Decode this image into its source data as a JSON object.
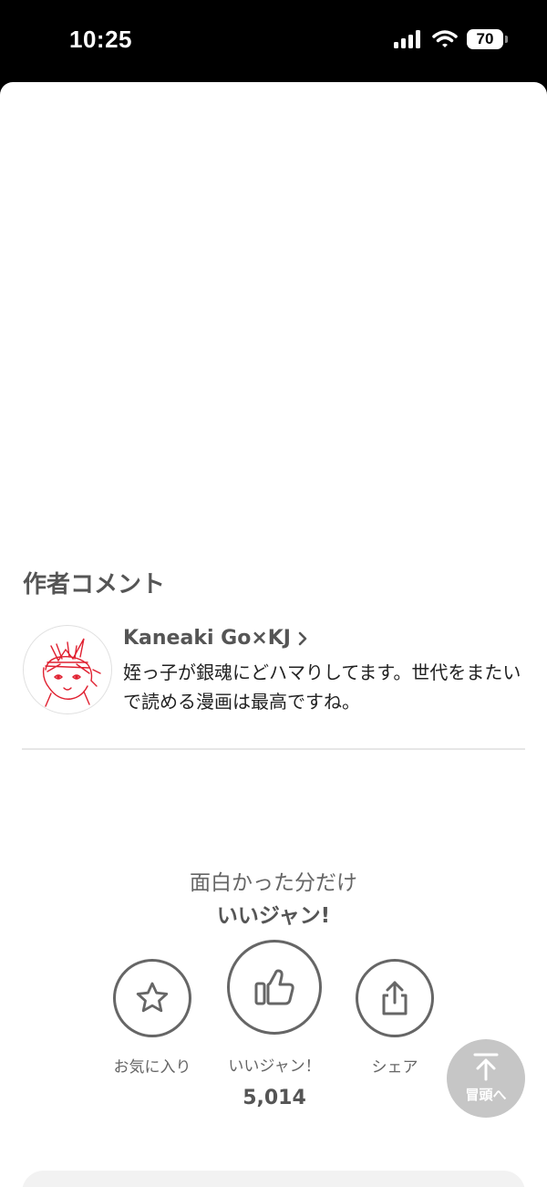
{
  "status_bar": {
    "time": "10:25",
    "battery": "70",
    "icons": [
      "signal-icon",
      "wifi-icon",
      "battery-icon"
    ]
  },
  "author_comment": {
    "section_title": "作者コメント",
    "author_name": "Kaneaki Go×KJ",
    "comment": "姪っ子が銀魂にどハマりしてます。世代をまたいで読める漫画は最高ですね。"
  },
  "promo": {
    "line1": "面白かった分だけ",
    "line2": "いいジャン!"
  },
  "actions": {
    "favorite_label": "お気に入り",
    "like_label": "いいジャン！",
    "like_count": "5,014",
    "share_label": "シェア"
  },
  "back_to_top": {
    "label": "冒頭へ"
  },
  "colors": {
    "icon_gray": "#666666",
    "text_dark": "#222222",
    "back_to_top_bg": "#c6c6c6",
    "avatar_sketch": "#e02030"
  }
}
